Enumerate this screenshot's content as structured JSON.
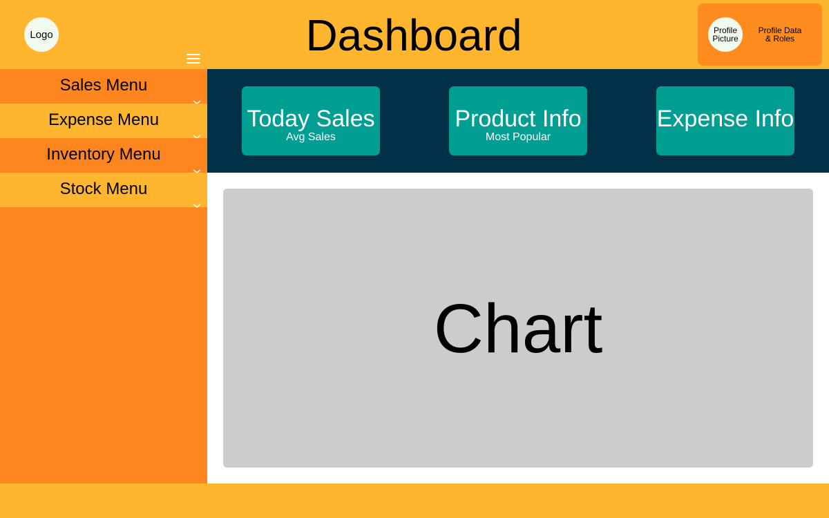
{
  "header": {
    "logo": "Logo",
    "title": "Dashboard",
    "profile_picture": "Profile\nPicture",
    "profile_data": "Profile Data\n& Roles"
  },
  "sidebar": {
    "items": [
      {
        "label": "Sales Menu"
      },
      {
        "label": "Expense Menu"
      },
      {
        "label": "Inventory Menu"
      },
      {
        "label": "Stock Menu"
      }
    ]
  },
  "stats": {
    "cards": [
      {
        "title": "Today Sales",
        "subtitle": "Avg Sales"
      },
      {
        "title": "Product Info",
        "subtitle": "Most Popular"
      },
      {
        "title": "Expense Info",
        "subtitle": ""
      }
    ]
  },
  "chart": {
    "label": "Chart"
  },
  "colors": {
    "header": "#FFB52E",
    "sidebar": "#FF851E",
    "stats_band": "#023049",
    "card": "#009E93",
    "chart_placeholder": "#CCCCCC"
  },
  "icons": {
    "menu": "hamburger-icon",
    "dropdown": "chevron-down-icon"
  }
}
